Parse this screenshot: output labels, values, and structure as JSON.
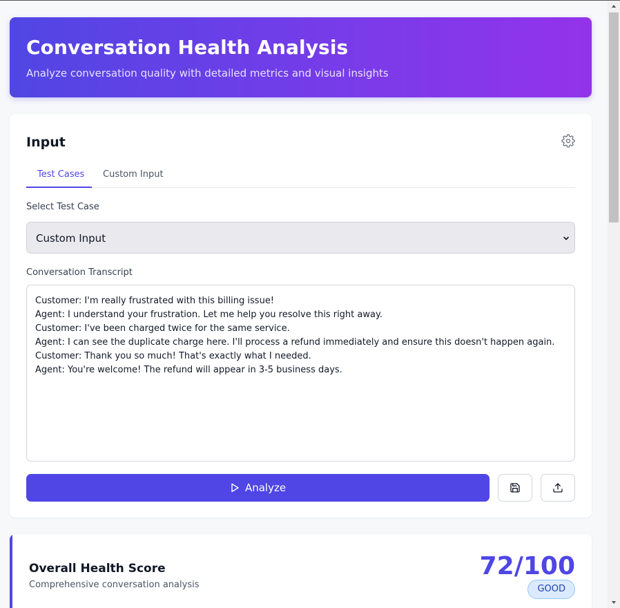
{
  "header": {
    "title": "Conversation Health Analysis",
    "subtitle": "Analyze conversation quality with detailed metrics and visual insights"
  },
  "input_card": {
    "title": "Input",
    "settings_icon": "gear-icon",
    "tabs": [
      {
        "label": "Test Cases",
        "active": true
      },
      {
        "label": "Custom Input",
        "active": false
      }
    ],
    "select_label": "Select Test Case",
    "select_value": "Custom Input",
    "transcript_label": "Conversation Transcript",
    "transcript": "Customer: I'm really frustrated with this billing issue!\nAgent: I understand your frustration. Let me help you resolve this right away.\nCustomer: I've been charged twice for the same service.\nAgent: I can see the duplicate charge here. I'll process a refund immediately and ensure this doesn't happen again.\nCustomer: Thank you so much! That's exactly what I needed.\nAgent: You're welcome! The refund will appear in 3-5 business days.",
    "analyze_label": "Analyze",
    "analyze_icon": "play-icon",
    "save_icon": "save-icon",
    "upload_icon": "upload-icon"
  },
  "score_card": {
    "title": "Overall Health Score",
    "subtitle": "Comprehensive conversation analysis",
    "score": "72/100",
    "badge": "GOOD"
  },
  "colors": {
    "accent": "#4f46e5",
    "gradient_start": "#5046e4",
    "gradient_end": "#9333ea"
  }
}
